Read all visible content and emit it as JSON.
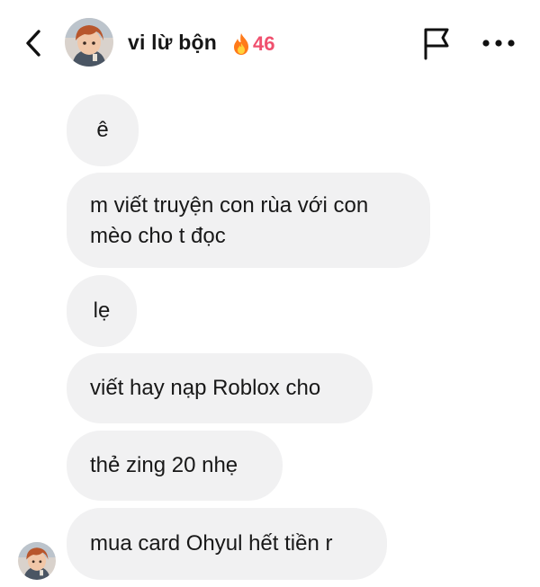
{
  "header": {
    "contact_name": "vi lừ bộn",
    "streak_count": "46",
    "icons": {
      "back": "chevron-left-icon",
      "streak": "fire-icon",
      "report": "flag-icon",
      "more": "more-horizontal-icon"
    }
  },
  "colors": {
    "bubble_bg": "#f1f1f2",
    "streak_text": "#f0506e",
    "fire_outer": "#ff7a1a",
    "fire_inner": "#ffd23a"
  },
  "messages": [
    {
      "text": "ê"
    },
    {
      "lines": [
        "m viết truyện con rùa với con",
        "mèo cho t đọc"
      ]
    },
    {
      "text": "lẹ"
    },
    {
      "text": "viết hay nạp Roblox cho"
    },
    {
      "text": "thẻ zing 20 nhẹ"
    },
    {
      "text": "mua card Ohyul hết tiền r"
    }
  ]
}
